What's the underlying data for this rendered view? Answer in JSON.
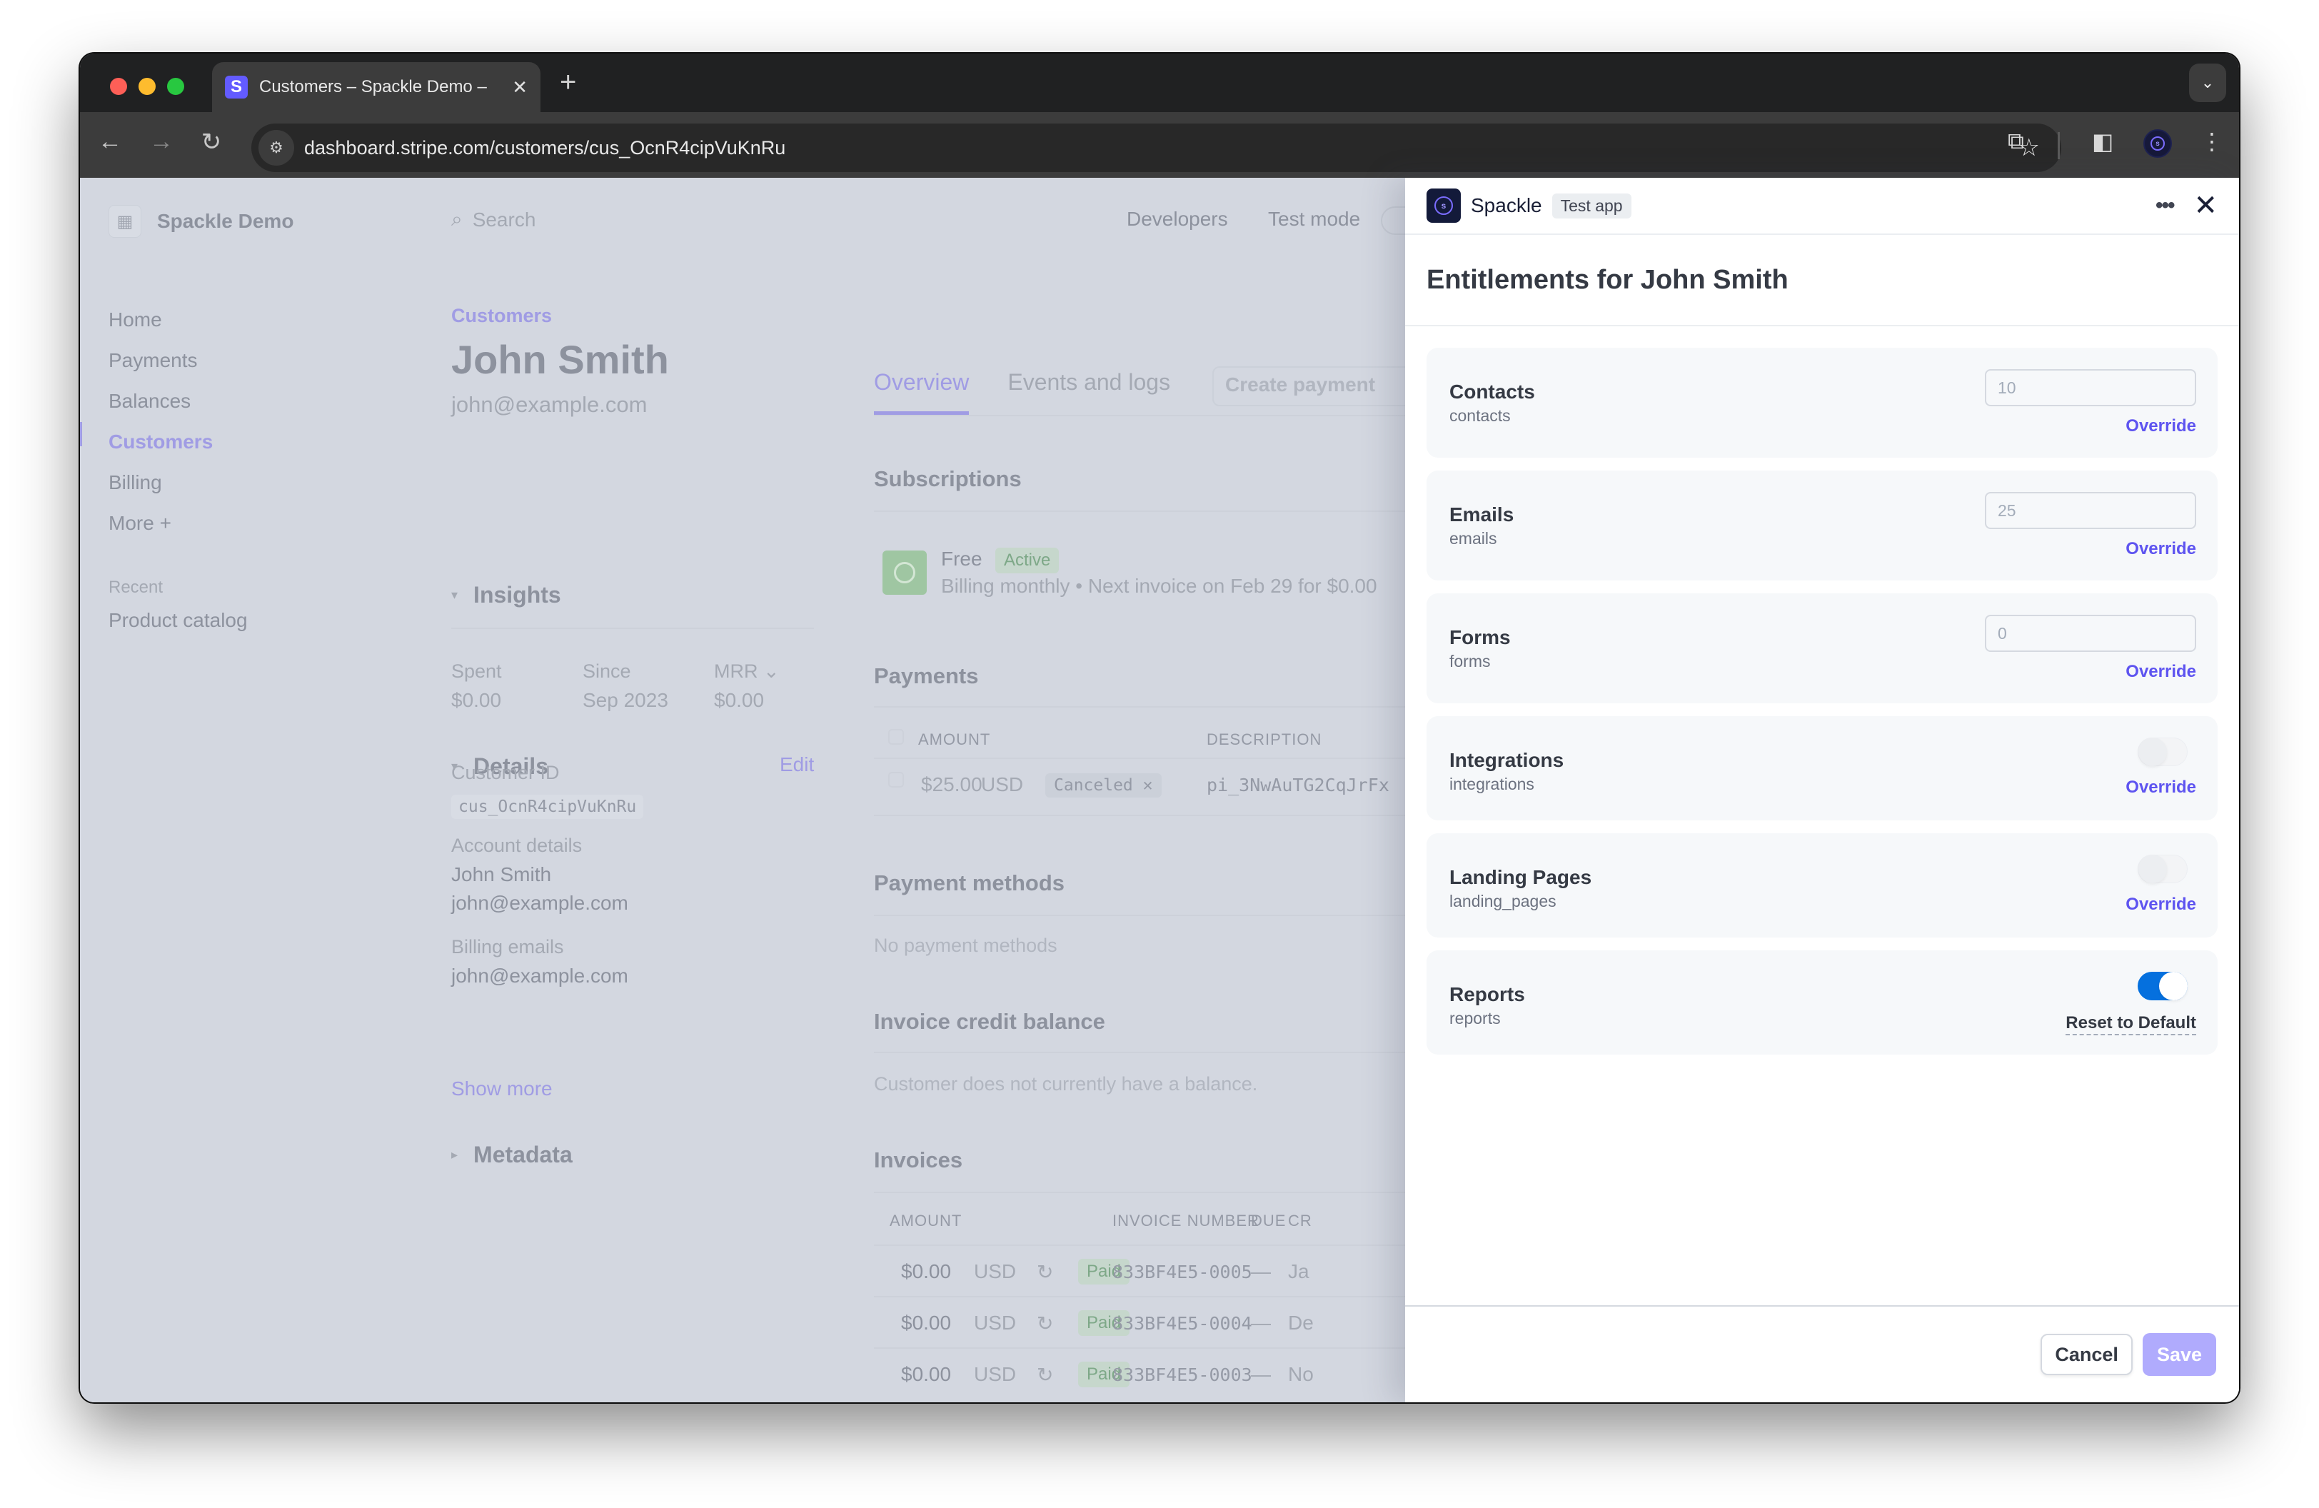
{
  "browser": {
    "tab_title": "Customers – Spackle Demo – ",
    "tab_favicon": "S",
    "tab_close": "✕",
    "new_tab": "+",
    "tab_menu_icon": "⌄",
    "url": "dashboard.stripe.com/customers/cus_OcnR4cipVuKnRu",
    "icons": {
      "back": "←",
      "forward": "→",
      "reload": "↻",
      "site_info": "⚙",
      "star": "☆",
      "extensions": "⧉",
      "side_panel": "◧",
      "profile": "s",
      "menu": "⋮"
    }
  },
  "header": {
    "account_name": "Spackle Demo",
    "account_icon": "▦",
    "search_icon": "⌕",
    "search_placeholder": "Search",
    "developers": "Developers",
    "test_mode": "Test mode"
  },
  "sidebar": {
    "items": [
      {
        "label": "Home"
      },
      {
        "label": "Payments"
      },
      {
        "label": "Balances"
      },
      {
        "label": "Customers",
        "active": true
      },
      {
        "label": "Billing"
      },
      {
        "label": "More +"
      }
    ],
    "recent_label": "Recent",
    "recent_items": [
      {
        "label": "Product catalog"
      }
    ]
  },
  "customer": {
    "breadcrumb": "Customers",
    "name": "John Smith",
    "email": "john@example.com",
    "insights": {
      "title": "Insights",
      "caret": "▾",
      "stats": [
        {
          "label": "Spent",
          "value": "$0.00"
        },
        {
          "label": "Since",
          "value": "Sep 2023"
        },
        {
          "label": "MRR",
          "value": "$0.00",
          "dropdown": "⌄"
        }
      ]
    },
    "details": {
      "title": "Details",
      "caret": "▾",
      "edit": "Edit",
      "customer_id_label": "Customer ID",
      "customer_id": "cus_OcnR4cipVuKnRu",
      "account_details_label": "Account details",
      "account_name": "John Smith",
      "account_email": "john@example.com",
      "billing_emails_label": "Billing emails",
      "billing_email": "john@example.com",
      "show_more": "Show more"
    },
    "metadata": {
      "title": "Metadata",
      "caret": "▸"
    }
  },
  "main": {
    "tabs": [
      {
        "label": "Overview",
        "active": true
      },
      {
        "label": "Events and logs"
      }
    ],
    "create_payment": "Create payment",
    "subscriptions": {
      "title": "Subscriptions",
      "plan": "Free",
      "status": "Active",
      "description": "Billing monthly • Next invoice on Feb 29 for $0.00"
    },
    "payments": {
      "title": "Payments",
      "columns": [
        "AMOUNT",
        "DESCRIPTION"
      ],
      "rows": [
        {
          "amount": "$25.00",
          "currency": "USD",
          "status": "Canceled",
          "status_icon": "✕",
          "description": "pi_3NwAuTG2CqJrFx"
        }
      ]
    },
    "payment_methods": {
      "title": "Payment methods",
      "empty": "No payment methods"
    },
    "credit_balance": {
      "title": "Invoice credit balance",
      "empty": "Customer does not currently have a balance."
    },
    "invoices": {
      "title": "Invoices",
      "columns": [
        "AMOUNT",
        "INVOICE NUMBER",
        "DUE",
        "CR"
      ],
      "rows": [
        {
          "amount": "$0.00",
          "currency": "USD",
          "recurring_icon": "↻",
          "status": "Paid",
          "number": "833BF4E5-0005",
          "due": "—",
          "created": "Ja"
        },
        {
          "amount": "$0.00",
          "currency": "USD",
          "recurring_icon": "↻",
          "status": "Paid",
          "number": "833BF4E5-0004",
          "due": "—",
          "created": "De"
        },
        {
          "amount": "$0.00",
          "currency": "USD",
          "recurring_icon": "↻",
          "status": "Paid",
          "number": "833BF4E5-0003",
          "due": "—",
          "created": "No"
        }
      ]
    }
  },
  "panel": {
    "app_name": "Spackle",
    "app_logo": "s",
    "badge": "Test app",
    "more_icon": "•••",
    "close_icon": "✕",
    "title": "Entitlements for John Smith",
    "entitlements": [
      {
        "name": "Contacts",
        "key": "contacts",
        "type": "number",
        "value": "10",
        "action": "Override"
      },
      {
        "name": "Emails",
        "key": "emails",
        "type": "number",
        "value": "25",
        "action": "Override"
      },
      {
        "name": "Forms",
        "key": "forms",
        "type": "number",
        "value": "0",
        "action": "Override"
      },
      {
        "name": "Integrations",
        "key": "integrations",
        "type": "toggle",
        "enabled": false,
        "action": "Override"
      },
      {
        "name": "Landing Pages",
        "key": "landing_pages",
        "type": "toggle",
        "enabled": false,
        "action": "Override"
      },
      {
        "name": "Reports",
        "key": "reports",
        "type": "toggle",
        "enabled": true,
        "action": "Reset to Default"
      }
    ],
    "cancel": "Cancel",
    "save": "Save"
  },
  "colors": {
    "accent": "#635bff",
    "override_link": "#5e54f0",
    "toggle_on": "#0570de",
    "save_disabled": "#b0abfd",
    "overlay": "#d3d7e0"
  }
}
